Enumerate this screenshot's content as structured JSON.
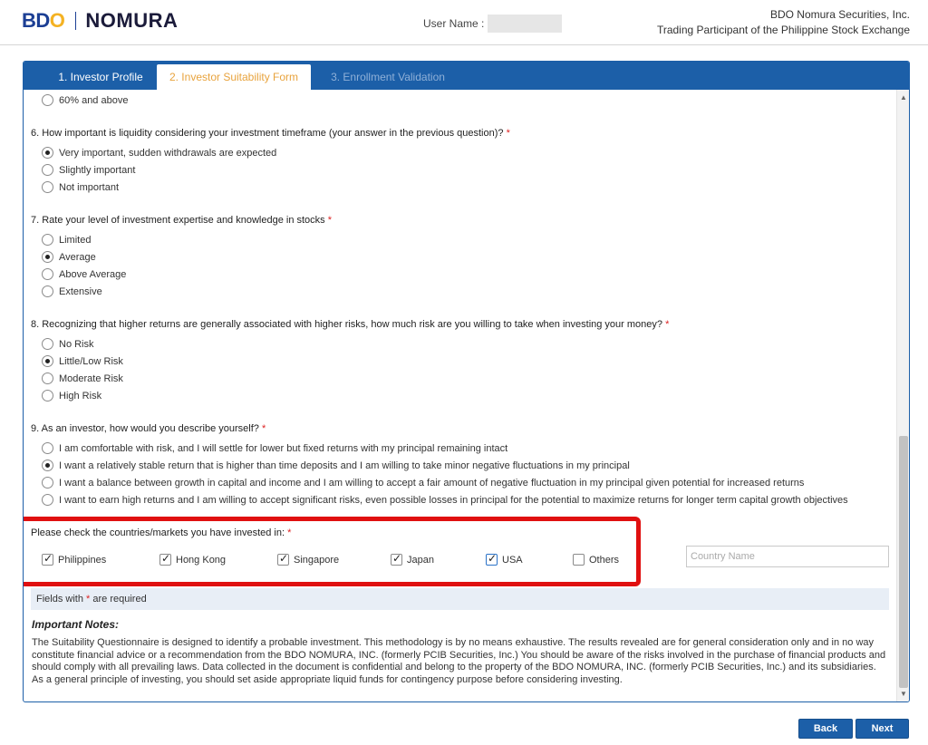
{
  "header": {
    "logo": {
      "b": "B",
      "d": "D",
      "o": "O",
      "nomura": "NOMURA"
    },
    "username_label": "User Name :",
    "company_line1": "BDO Nomura Securities, Inc.",
    "company_line2": "Trading Participant of the Philippine Stock Exchange"
  },
  "tabs": [
    {
      "label": "1. Investor Profile"
    },
    {
      "label": "2. Investor Suitability Form"
    },
    {
      "label": "3. Enrollment Validation"
    }
  ],
  "q5": {
    "options": [
      {
        "label": "60% and above",
        "checked": false
      }
    ]
  },
  "q6": {
    "question": "6. How important is liquidity considering your investment timeframe (your answer in the previous question)?",
    "options": [
      {
        "label": "Very important, sudden withdrawals are expected",
        "checked": true
      },
      {
        "label": "Slightly important",
        "checked": false
      },
      {
        "label": "Not important",
        "checked": false
      }
    ]
  },
  "q7": {
    "question": "7. Rate your level of investment expertise and knowledge in stocks",
    "options": [
      {
        "label": "Limited",
        "checked": false
      },
      {
        "label": "Average",
        "checked": true
      },
      {
        "label": "Above Average",
        "checked": false
      },
      {
        "label": "Extensive",
        "checked": false
      }
    ]
  },
  "q8": {
    "question": "8. Recognizing that higher returns are generally associated with higher risks, how much risk are you willing to take when investing your money?",
    "options": [
      {
        "label": "No Risk",
        "checked": false
      },
      {
        "label": "Little/Low Risk",
        "checked": true
      },
      {
        "label": "Moderate Risk",
        "checked": false
      },
      {
        "label": "High Risk",
        "checked": false
      }
    ]
  },
  "q9": {
    "question": "9. As an investor, how would you describe yourself?",
    "options": [
      {
        "label": "I am comfortable with risk, and I will settle for lower but fixed returns with my principal remaining intact",
        "checked": false
      },
      {
        "label": "I want a relatively stable return that is higher than time deposits and I am willing to take minor negative fluctuations in my principal",
        "checked": true
      },
      {
        "label": "I want a balance between growth in capital and income and I am willing to accept a fair amount of negative fluctuation in my principal given potential for increased returns",
        "checked": false
      },
      {
        "label": "I want to earn high returns and I am willing to accept significant risks, even possible losses in principal for the potential to maximize returns for longer term capital growth objectives",
        "checked": false
      }
    ]
  },
  "markets": {
    "question": "Please check the countries/markets you have invested in:",
    "items": [
      {
        "label": "Philippines",
        "checked": true
      },
      {
        "label": "Hong Kong",
        "checked": true
      },
      {
        "label": "Singapore",
        "checked": true
      },
      {
        "label": "Japan",
        "checked": true
      },
      {
        "label": "USA",
        "checked": true
      },
      {
        "label": "Others",
        "checked": false
      }
    ],
    "country_placeholder": "Country Name"
  },
  "required_note": {
    "prefix": "Fields with",
    "star": "*",
    "suffix": "are required"
  },
  "notes": {
    "title": "Important Notes:",
    "text": "The Suitability Questionnaire is designed to identify a probable investment. This methodology is by no means exhaustive. The results revealed are for general consideration only and in no way constitute financial advice or a recommendation from the BDO NOMURA, INC. (formerly PCIB Securities, Inc.) You should be aware of the risks involved in the purchase of financial products and should comply with all prevailing laws. Data collected in the document is confidential and belong to the property of the BDO NOMURA, INC. (formerly PCIB Securities, Inc.) and its subsidiaries. As a general principle of investing, you should set aside appropriate liquid funds for contingency purpose before considering investing."
  },
  "buttons": {
    "back": "Back",
    "next": "Next"
  },
  "star": "*"
}
